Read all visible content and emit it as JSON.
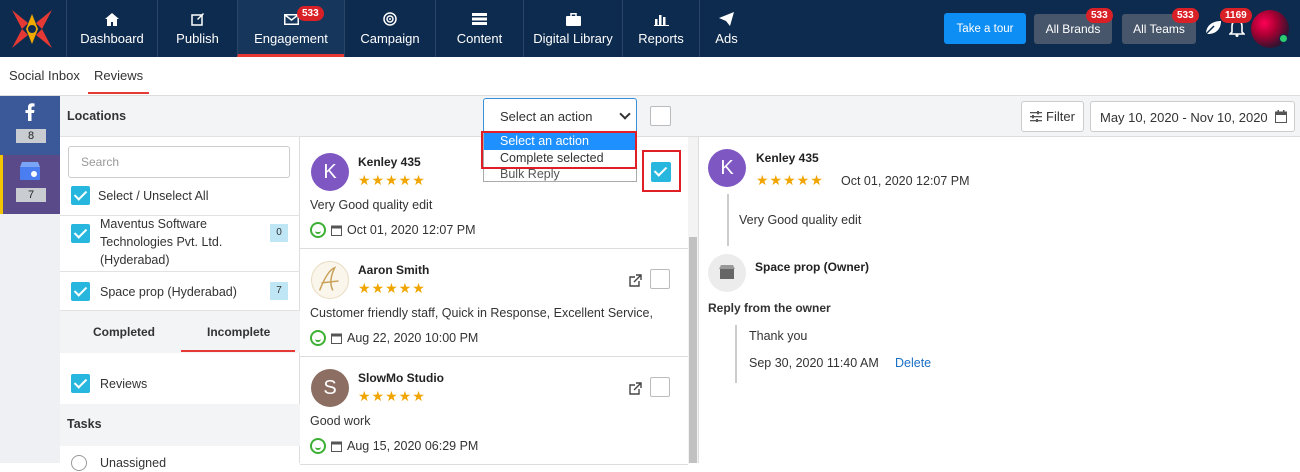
{
  "nav": {
    "items": [
      {
        "label": "Dashboard",
        "icon": "home-icon"
      },
      {
        "label": "Publish",
        "icon": "edit-icon"
      },
      {
        "label": "Engagement",
        "icon": "envelope-icon",
        "badge": "533"
      },
      {
        "label": "Campaign",
        "icon": "target-icon"
      },
      {
        "label": "Content",
        "icon": "list-icon"
      },
      {
        "label": "Digital Library",
        "icon": "briefcase-icon"
      },
      {
        "label": "Reports",
        "icon": "bar-chart-icon"
      },
      {
        "label": "Ads",
        "icon": "paper-plane-icon"
      }
    ],
    "tour": "Take a tour",
    "brands": "All Brands",
    "brands_badge": "533",
    "teams": "All Teams",
    "teams_badge": "533",
    "bell_badge": "1169"
  },
  "subtabs": [
    "Social Inbox",
    "Reviews"
  ],
  "rail": {
    "facebook_count": "8",
    "google_count": "7"
  },
  "locations": {
    "title": "Locations",
    "search_placeholder": "Search",
    "select_all": "Select / Unselect All",
    "items": [
      {
        "name": "Maventus Software Technologies Pvt. Ltd. (Hyderabad)",
        "count": "0"
      },
      {
        "name": "Space prop (Hyderabad)",
        "count": "7"
      }
    ],
    "tab_completed": "Completed",
    "tab_incomplete": "Incomplete",
    "reviews_label": "Reviews",
    "tasks_title": "Tasks",
    "tasks_first": "Unassigned"
  },
  "toolbar": {
    "select_value": "Select an action",
    "options": [
      "Select an action",
      "Complete selected",
      "Bulk Reply"
    ],
    "filter": "Filter",
    "date_range": "May 10, 2020 - Nov 10, 2020"
  },
  "reviews": [
    {
      "initial": "K",
      "name": "Kenley 435",
      "stars": "★★★★★",
      "text": "Very Good quality edit",
      "date": "Oct 01, 2020 12:07 PM",
      "avatar_color": "#7e57c2"
    },
    {
      "initial": "A",
      "name": "Aaron Smith",
      "stars": "★★★★★",
      "text": "Customer friendly staff, Quick in Response, Excellent Service,",
      "date": "Aug 22, 2020 10:00 PM",
      "avatar_color": "#d9b46a"
    },
    {
      "initial": "S",
      "name": "SlowMo Studio",
      "stars": "★★★★★",
      "text": "Good work",
      "date": "Aug 15, 2020 06:29 PM",
      "avatar_color": "#8d6e63"
    }
  ],
  "detail": {
    "initial": "K",
    "name": "Kenley 435",
    "stars": "★★★★★",
    "date": "Oct 01, 2020 12:07 PM",
    "text": "Very Good quality edit",
    "owner_name": "Space prop (Owner)",
    "reply_from": "Reply from the owner",
    "reply_text": "Thank you",
    "reply_date": "Sep 30, 2020 11:40 AM",
    "delete": "Delete"
  },
  "colors": {
    "nav_bg": "#0d2b4e",
    "accent": "#27b7de",
    "badge": "#d92027",
    "star": "#f0a500",
    "link": "#1a6fc4"
  }
}
